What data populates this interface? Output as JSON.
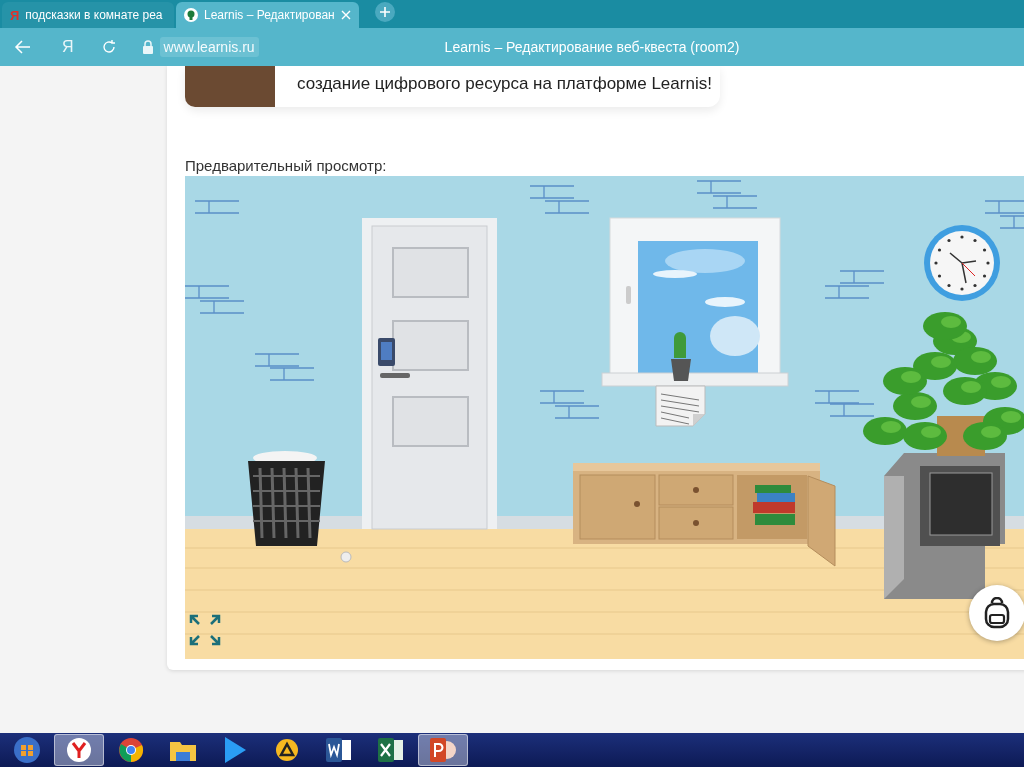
{
  "browser": {
    "tabs": [
      {
        "favicon": "Я",
        "title": "подсказки в комнате реа",
        "selected": false
      },
      {
        "title": "Learnis – Редактирован",
        "selected": true
      }
    ],
    "home_button": "Я",
    "address": "www.learnis.ru",
    "page_title": "Learnis – Редактирование веб-квеста (room2)"
  },
  "info_card": {
    "text": "создание цифрового ресурса на платформе Learnis!"
  },
  "preview": {
    "label": "Предварительный просмотр:"
  },
  "taskbar": {
    "buttons": [
      {
        "selected": false
      },
      {
        "selected": true
      },
      {
        "selected": false
      },
      {
        "selected": false
      },
      {
        "selected": false
      },
      {
        "selected": false
      },
      {
        "selected": false
      },
      {
        "selected": false
      },
      {
        "selected": true
      }
    ]
  }
}
